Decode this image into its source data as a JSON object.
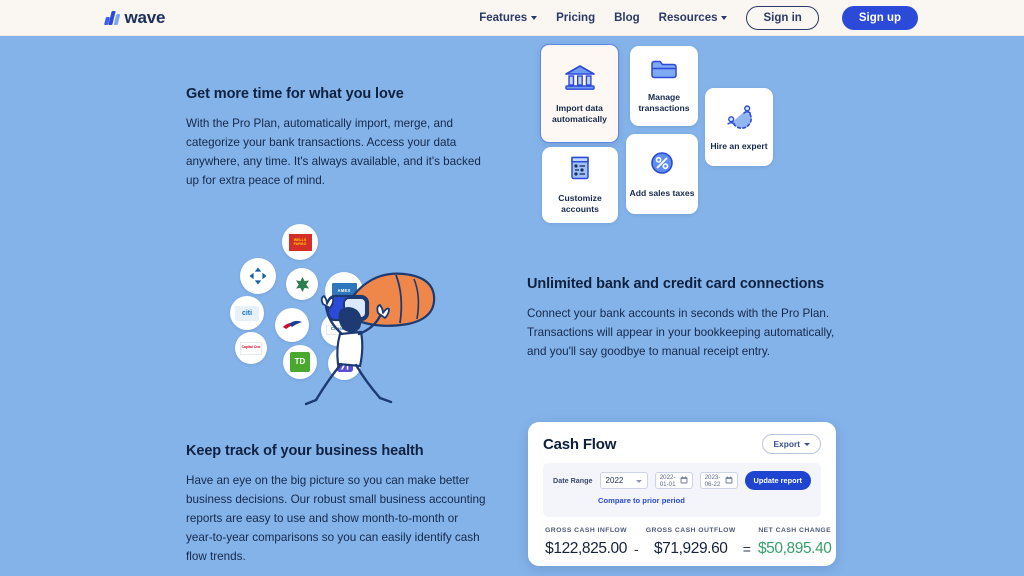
{
  "header": {
    "logo_text": "wave",
    "nav": [
      {
        "label": "Features",
        "has_dropdown": true
      },
      {
        "label": "Pricing",
        "has_dropdown": false
      },
      {
        "label": "Blog",
        "has_dropdown": false
      },
      {
        "label": "Resources",
        "has_dropdown": true
      }
    ],
    "signin_label": "Sign in",
    "signup_label": "Sign up"
  },
  "sections": {
    "time": {
      "title": "Get more time for what you love",
      "body": "With the Pro Plan, automatically import, merge, and categorize your bank transactions. Access your data anywhere, any time. It's always available, and it's backed up for extra peace of mind."
    },
    "connections": {
      "title": "Unlimited bank and credit card connections",
      "body": "Connect your bank accounts in seconds with the Pro Plan. Transactions will appear in your bookkeeping automatically, and you'll say goodbye to manual receipt entry."
    },
    "health": {
      "title": "Keep track of your business health",
      "body": "Have an eye on the big picture so you can make better business decisions. Our robust small business accounting reports are easy to use and show month-to-month or year-to-year comparisons so you can easily identify cash flow trends."
    }
  },
  "feature_cards": [
    {
      "id": "import",
      "label": "Import data automatically",
      "icon": "bank-building-icon",
      "highlighted": true
    },
    {
      "id": "manage",
      "label": "Manage transactions",
      "icon": "folder-icon",
      "highlighted": false
    },
    {
      "id": "hire",
      "label": "Hire an expert",
      "icon": "people-refresh-icon",
      "highlighted": false
    },
    {
      "id": "customize",
      "label": "Customize accounts",
      "icon": "list-document-icon",
      "highlighted": false
    },
    {
      "id": "taxes",
      "label": "Add sales taxes",
      "icon": "percent-circle-icon",
      "highlighted": false
    }
  ],
  "bank_badges": [
    {
      "name": "Wells Fargo",
      "short": "WELLS FARGO",
      "color": "#d32f27"
    },
    {
      "name": "Chase",
      "short": "",
      "color": "#1261a8"
    },
    {
      "name": "Citi",
      "short": "citi",
      "color": "#1273c4"
    },
    {
      "name": "Regions",
      "short": "",
      "color": "#2e7d4f"
    },
    {
      "name": "Bank of America",
      "short": "",
      "color": "#c8102e"
    },
    {
      "name": "Capital One",
      "short": "Capital One",
      "color": "#d03027"
    },
    {
      "name": "American Express",
      "short": "AMEX",
      "color": "#2e77bc"
    },
    {
      "name": "Chase Bank",
      "short": "Chase",
      "color": "#1261a8"
    },
    {
      "name": "TD Bank",
      "short": "TD",
      "color": "#4ba82e"
    },
    {
      "name": "Scotiabank",
      "short": "",
      "color": "#5b4fd6"
    }
  ],
  "cash_flow": {
    "title": "Cash Flow",
    "export_label": "Export",
    "date_range_label": "Date Range",
    "range_value": "2022",
    "date_from": "2022-01-01",
    "date_to": "2023-06-22",
    "update_label": "Update report",
    "compare_label": "Compare to prior period",
    "stats": [
      {
        "label": "GROSS CASH INFLOW",
        "value": "$122,825.00",
        "green": false
      },
      {
        "label": "GROSS CASH OUTFLOW",
        "value": "$71,929.60",
        "green": false
      },
      {
        "label": "NET CASH CHANGE",
        "value": "$50,895.40",
        "green": true
      }
    ],
    "operators": [
      "-",
      "="
    ]
  },
  "colors": {
    "page_background": "#84b3ea",
    "header_background": "#faf6f1",
    "brand_blue": "#2b4ad8",
    "heading_navy": "#10213f",
    "positive_green": "#38a06b",
    "highlight_card": "#fdf8f3"
  }
}
